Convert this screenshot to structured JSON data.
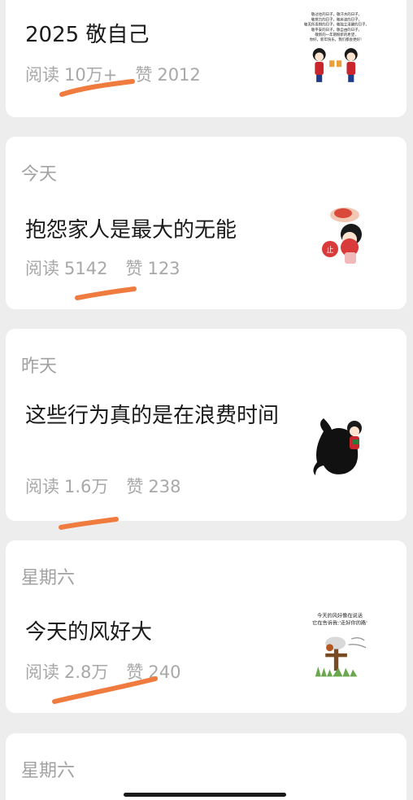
{
  "posts": [
    {
      "date": "",
      "title": "2025  敬自己",
      "read_label": "阅读",
      "read_count": "10万+",
      "like_label": "赞",
      "like_count": "2012",
      "thumb_icon": "cheers-cartoon-thumbnail",
      "thumb_text": [
        "敬过往的日子，敬汗水的日子，",
        "敬努力的日子，敬奔波的日子，",
        "敬无所畏惧的日子，敬独立清醒的日子，",
        "敬平安的日子，敬自由的日子，",
        "敬新的一年期盼新的希望，",
        "你好，新年快乐，我们都会更好！"
      ]
    },
    {
      "date": "今天",
      "title": "抱怨家人是最大的无能",
      "read_label": "阅读",
      "read_count": "5142",
      "like_label": "赞",
      "like_count": "123",
      "thumb_icon": "girl-with-fan-thumbnail"
    },
    {
      "date": "昨天",
      "title": "这些行为真的是在浪费时间",
      "read_label": "阅读",
      "read_count": "1.6万",
      "like_label": "赞",
      "like_count": "238",
      "thumb_icon": "girl-with-black-cat-thumbnail"
    },
    {
      "date": "星期六",
      "title": "今天的风好大",
      "read_label": "阅读",
      "read_count": "2.8万",
      "like_label": "赞",
      "like_count": "240",
      "thumb_icon": "scarecrow-wind-thumbnail",
      "thumb_text": [
        "今天的风好像在说话",
        "它在告诉我:'走好你的路'"
      ]
    },
    {
      "date": "星期六"
    }
  ],
  "colors": {
    "background": "#ededed",
    "card": "#ffffff",
    "title": "#1a1a1a",
    "meta": "#a8a8a8",
    "annotation": "#f07b3f"
  }
}
